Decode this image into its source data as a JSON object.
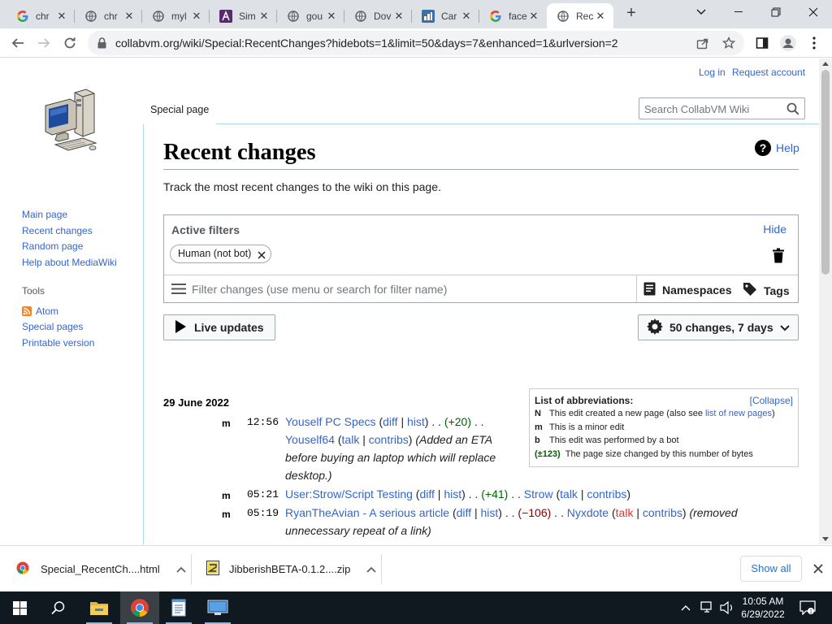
{
  "browser": {
    "tabs": [
      {
        "label": "chr",
        "favicon": "google-g-icon"
      },
      {
        "label": "chr",
        "favicon": "globe-icon"
      },
      {
        "label": "myl",
        "favicon": "globe-icon"
      },
      {
        "label": "Sim",
        "favicon": "site-icon"
      },
      {
        "label": "gou",
        "favicon": "globe-icon"
      },
      {
        "label": "Dov",
        "favicon": "globe-icon"
      },
      {
        "label": "Car",
        "favicon": "site-icon"
      },
      {
        "label": "face",
        "favicon": "google-g-icon"
      },
      {
        "label": "Rec",
        "favicon": "globe-icon",
        "active": true
      }
    ],
    "url": "collabvm.org/wiki/Special:RecentChanges?hidebots=1&limit=50&days=7&enhanced=1&urlversion=2"
  },
  "wiki": {
    "personal": {
      "login": "Log in",
      "request_account": "Request account"
    },
    "sidebar": {
      "nav": [
        "Main page",
        "Recent changes",
        "Random page",
        "Help about MediaWiki"
      ],
      "tools_heading": "Tools",
      "tools": [
        "Atom",
        "Special pages",
        "Printable version"
      ]
    },
    "special_tab": "Special page",
    "search_placeholder": "Search CollabVM Wiki",
    "title": "Recent changes",
    "help": "Help",
    "description": "Track the most recent changes to the wiki on this page.",
    "filters": {
      "heading": "Active filters",
      "hide": "Hide",
      "chip": "Human (not bot)",
      "input_placeholder": "Filter changes (use menu or search for filter name)",
      "namespaces": "Namespaces",
      "tags": "Tags"
    },
    "live_updates": "Live updates",
    "changes_button": "50 changes, 7 days",
    "abbreviations": {
      "heading": "List of abbreviations:",
      "collapse": "[Collapse]",
      "rows": [
        {
          "key": "N",
          "text": "This edit created a new page (also see ",
          "link": "list of new pages",
          "after": ")"
        },
        {
          "key": "m",
          "text": "This is a minor edit"
        },
        {
          "key": "b",
          "text": "This edit was performed by a bot"
        },
        {
          "key": "(±123)",
          "text": "The page size changed by this number of bytes"
        }
      ]
    },
    "date_heading": "29 June 2022",
    "entries": [
      {
        "flag": "m",
        "time": "12:56",
        "page": "Youself PC Specs",
        "diff": "diff",
        "hist": "hist",
        "size": "(+20)",
        "user": "Youself64",
        "talk": "talk",
        "contribs": "contribs",
        "summary": [
          "(Added an ETA",
          "before buying an laptop which will replace",
          "desktop.)"
        ]
      },
      {
        "flag": "m",
        "time": "05:21",
        "page": "User:Strow/Script Testing",
        "diff": "diff",
        "hist": "hist",
        "size": "(+41)",
        "user": "Strow",
        "talk": "talk",
        "contribs": "contribs"
      },
      {
        "flag": "m",
        "time": "05:19",
        "page": "RyanTheAvian - A serious article",
        "diff": "diff",
        "hist": "hist",
        "size": "(−106)",
        "user": "Nyxdote",
        "talk": "talk",
        "contribs": "contribs",
        "summary": [
          "(removed",
          "unnecessary repeat of a link)"
        ]
      }
    ]
  },
  "downloads": {
    "items": [
      {
        "name": "Special_RecentCh....html",
        "icon": "chrome-file-icon"
      },
      {
        "name": "JibberishBETA-0.1.2....zip",
        "icon": "zip-file-icon"
      }
    ],
    "show_all": "Show all"
  },
  "taskbar": {
    "time": "10:05 AM",
    "date": "6/29/2022"
  },
  "colors": {
    "link": "#3366cc",
    "redlink": "#dd3333",
    "positive": "#006400",
    "negative": "#8b0000",
    "tabstrip": "#dee1e6",
    "taskbar": "#101820"
  }
}
